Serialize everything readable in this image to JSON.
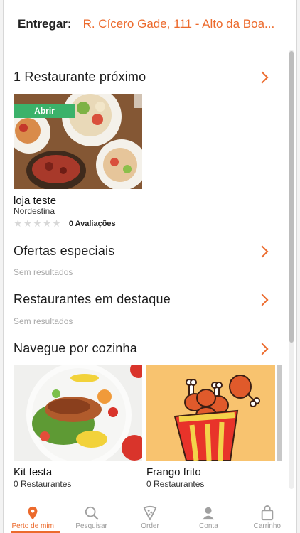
{
  "header": {
    "deliver_label": "Entregar:",
    "address": "R. Cícero Gade, 111 - Alto da Boa..."
  },
  "sections": {
    "nearby": {
      "title": "1 Restaurante próximo",
      "restaurant": {
        "badge": "Abrir",
        "name": "loja teste",
        "category": "Nordestina",
        "rating": 0,
        "reviews": "0 Avaliações"
      }
    },
    "offers": {
      "title": "Ofertas especiais",
      "empty": "Sem resultados"
    },
    "featured": {
      "title": "Restaurantes em destaque",
      "empty": "Sem resultados"
    },
    "cuisines": {
      "title": "Navegue por cozinha",
      "items": [
        {
          "name": "Kit festa",
          "count": "0 Restaurantes"
        },
        {
          "name": "Frango frito",
          "count": "0 Restaurantes"
        }
      ]
    }
  },
  "bottom_nav": {
    "items": [
      {
        "label": "Perto de mim",
        "icon": "map-pin-icon",
        "active": true
      },
      {
        "label": "Pesquisar",
        "icon": "search-icon",
        "active": false
      },
      {
        "label": "Order",
        "icon": "pizza-icon",
        "active": false
      },
      {
        "label": "Conta",
        "icon": "user-icon",
        "active": false
      },
      {
        "label": "Carrinho",
        "icon": "bag-icon",
        "active": false
      }
    ]
  },
  "colors": {
    "accent": "#ec6a2c",
    "open_badge": "#3bb26a"
  }
}
